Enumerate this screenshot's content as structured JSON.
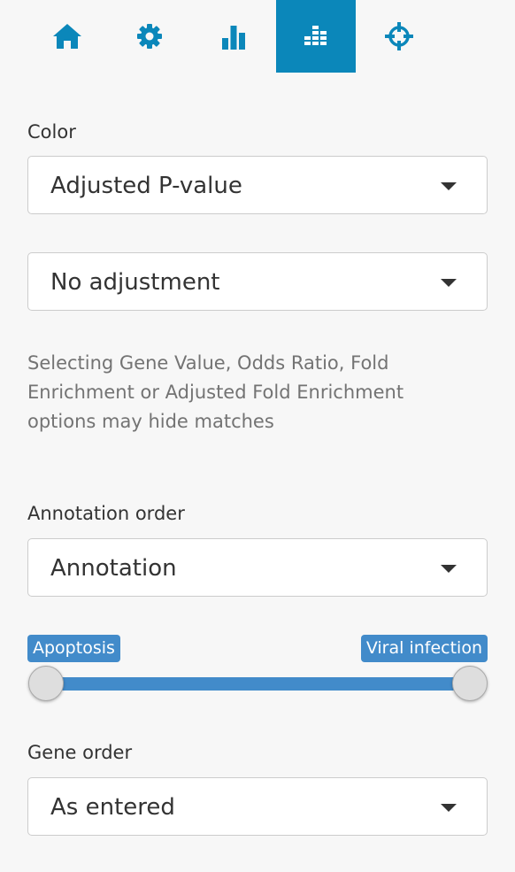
{
  "tabs": [
    {
      "icon": "home-icon"
    },
    {
      "icon": "gear-icon"
    },
    {
      "icon": "bar-chart-icon"
    },
    {
      "icon": "heatmap-icon",
      "active": true
    },
    {
      "icon": "crosshair-icon"
    }
  ],
  "colors": {
    "accent": "#0b87ba",
    "slider": "#428bca",
    "background": "#f7f7f7"
  },
  "color": {
    "label": "Color",
    "metric": "Adjusted P-value",
    "adjustment": "No adjustment",
    "help": "Selecting Gene Value, Odds Ratio, Fold Enrichment or Adjusted Fold Enrichment options may hide matches"
  },
  "annotation_order": {
    "label": "Annotation order",
    "value": "Annotation"
  },
  "range_slider": {
    "from_label": "Apoptosis",
    "to_label": "Viral infection"
  },
  "gene_order": {
    "label": "Gene order",
    "value": "As entered"
  }
}
